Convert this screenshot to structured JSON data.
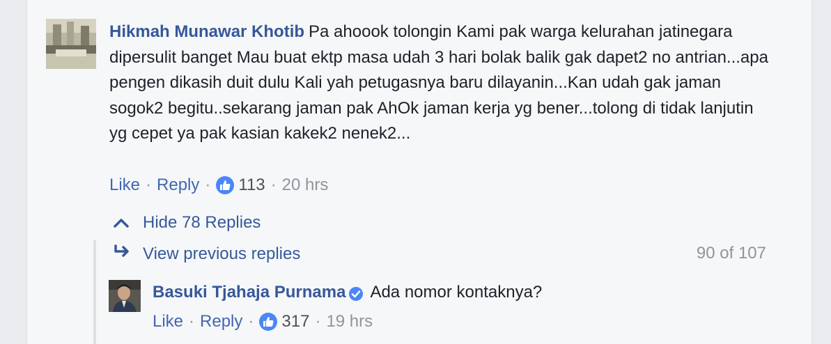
{
  "comment": {
    "author": "Hikmah Munawar Khotib",
    "text": "Pa ahoook tolongin Kami pak warga kelurahan jatinegara dipersulit banget Mau buat ektp masa udah 3 hari bolak balik gak dapet2 no antrian...apa pengen dikasih duit dulu Kali yah petugasnya baru dilayanin...Kan udah gak jaman sogok2 begitu..sekarang jaman pak AhOk jaman kerja yg bener...tolong di tidak lanjutin yg cepet ya pak kasian kakek2 nenek2...",
    "like_label": "Like",
    "reply_label": "Reply",
    "reactions": "113",
    "time": "20 hrs"
  },
  "replies": {
    "hide_label": "Hide 78 Replies",
    "view_previous_label": "View previous replies",
    "pager": "90 of 107"
  },
  "reply": {
    "author": "Basuki Tjahaja Purnama",
    "text": "Ada nomor kontaknya?",
    "like_label": "Like",
    "reply_label": "Reply",
    "reactions": "317",
    "time": "19 hrs"
  },
  "colors": {
    "link": "#365899",
    "muted": "#90949c",
    "like_badge": "#4a86f7",
    "background": "#f6f7f9"
  },
  "icons": {
    "hide_icon": "chevron-up-icon",
    "view_previous_icon": "reply-arrow-icon",
    "reaction_icon": "thumbs-up-icon",
    "verified_icon": "verified-badge-icon"
  }
}
